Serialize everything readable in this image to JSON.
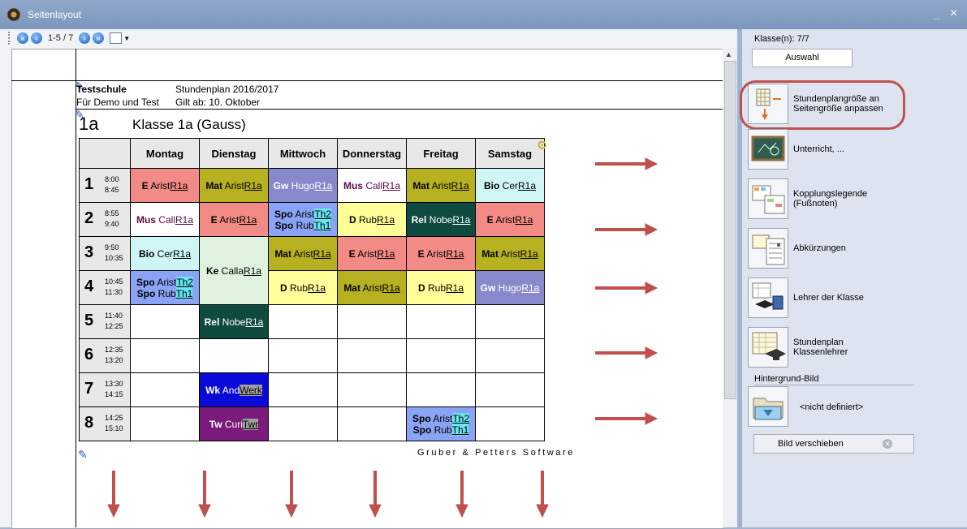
{
  "window": {
    "title": "Seitenlayout",
    "minimize": "_",
    "close": "×"
  },
  "toolbar": {
    "page_info": "1-5 / 7"
  },
  "header": {
    "school": "Testschule",
    "demo": "Für Demo und Test",
    "plan": "Stundenplan 2016/2017",
    "valid": "Gilt ab: 10. Oktober"
  },
  "class": {
    "code": "1a",
    "name": "Klasse 1a (Gauss)"
  },
  "days": [
    "Montag",
    "Dienstag",
    "Mittwoch",
    "Donnerstag",
    "Freitag",
    "Samstag"
  ],
  "periods": [
    {
      "num": "1",
      "start": "8:00",
      "end": "8:45"
    },
    {
      "num": "2",
      "start": "8:55",
      "end": "9:40"
    },
    {
      "num": "3",
      "start": "9:50",
      "end": "10:35"
    },
    {
      "num": "4",
      "start": "10:45",
      "end": "11:30"
    },
    {
      "num": "5",
      "start": "11:40",
      "end": "12:25"
    },
    {
      "num": "6",
      "start": "12:35",
      "end": "13:20"
    },
    {
      "num": "7",
      "start": "13:30",
      "end": "14:15"
    },
    {
      "num": "8",
      "start": "14:25",
      "end": "15:10"
    }
  ],
  "lessons": {
    "p1": [
      {
        "lines": [
          {
            "subj": "E",
            "teacher": "Arist",
            "room": "R1a"
          }
        ],
        "bg": "#f28b86",
        "fg": "#000"
      },
      {
        "lines": [
          {
            "subj": "Mat",
            "teacher": "Arist",
            "room": "R1a"
          }
        ],
        "bg": "#b7b020",
        "fg": "#000"
      },
      {
        "lines": [
          {
            "subj": "Gw",
            "teacher": "Hugo",
            "room": "R1a"
          }
        ],
        "bg": "#8888cc",
        "fg": "#fff"
      },
      {
        "lines": [
          {
            "subj": "Mus",
            "teacher": "Call",
            "room": "R1a"
          }
        ],
        "bg": "#ffffff",
        "fg": "#5a0a4a"
      },
      {
        "lines": [
          {
            "subj": "Mat",
            "teacher": "Arist",
            "room": "R1a"
          }
        ],
        "bg": "#b7b020",
        "fg": "#000"
      },
      {
        "lines": [
          {
            "subj": "Bio",
            "teacher": "Cer",
            "room": "R1a"
          }
        ],
        "bg": "#cff5f5",
        "fg": "#000"
      }
    ],
    "p2": [
      {
        "lines": [
          {
            "subj": "Mus",
            "teacher": "Call",
            "room": "R1a"
          }
        ],
        "bg": "#ffffff",
        "fg": "#5a0a4a"
      },
      {
        "lines": [
          {
            "subj": "E",
            "teacher": "Arist",
            "room": "R1a"
          }
        ],
        "bg": "#f28b86",
        "fg": "#000"
      },
      {
        "lines": [
          {
            "subj": "Spo",
            "teacher": "Arist",
            "room": "Th2"
          },
          {
            "subj": "Spo",
            "teacher": "Rub",
            "room": "Th1"
          }
        ],
        "bg": "#8aa3f5",
        "fg": "#000"
      },
      {
        "lines": [
          {
            "subj": "D",
            "teacher": "Rub",
            "room": "R1a"
          }
        ],
        "bg": "#ffff99",
        "fg": "#000"
      },
      {
        "lines": [
          {
            "subj": "Rel",
            "teacher": "Nobe",
            "room": "R1a"
          }
        ],
        "bg": "#0e4a40",
        "fg": "#fff"
      },
      {
        "lines": [
          {
            "subj": "E",
            "teacher": "Arist",
            "room": "R1a"
          }
        ],
        "bg": "#f28b86",
        "fg": "#000"
      }
    ],
    "p3": [
      {
        "lines": [
          {
            "subj": "Bio",
            "teacher": "Cer",
            "room": "R1a"
          }
        ],
        "bg": "#cff5f5",
        "fg": "#000"
      },
      {
        "lines": [
          {
            "subj": "Ke",
            "teacher": "Calla",
            "room": "R1a"
          }
        ],
        "bg": "#def2de",
        "fg": "#000",
        "rowspan": 2
      },
      {
        "lines": [
          {
            "subj": "Mat",
            "teacher": "Arist",
            "room": "R1a"
          }
        ],
        "bg": "#b7b020",
        "fg": "#000"
      },
      {
        "lines": [
          {
            "subj": "E",
            "teacher": "Arist",
            "room": "R1a"
          }
        ],
        "bg": "#f28b86",
        "fg": "#000"
      },
      {
        "lines": [
          {
            "subj": "E",
            "teacher": "Arist",
            "room": "R1a"
          }
        ],
        "bg": "#f28b86",
        "fg": "#000"
      },
      {
        "lines": [
          {
            "subj": "Mat",
            "teacher": "Arist",
            "room": "R1a"
          }
        ],
        "bg": "#b7b020",
        "fg": "#000"
      }
    ],
    "p4": [
      {
        "lines": [
          {
            "subj": "Spo",
            "teacher": "Arist",
            "room": "Th2"
          },
          {
            "subj": "Spo",
            "teacher": "Rub",
            "room": "Th1"
          }
        ],
        "bg": "#8aa3f5",
        "fg": "#000"
      },
      {
        "lines": [
          {
            "subj": "D",
            "teacher": "Rub",
            "room": "R1a"
          }
        ],
        "bg": "#ffff99",
        "fg": "#000"
      },
      {
        "lines": [
          {
            "subj": "Mat",
            "teacher": "Arist",
            "room": "R1a"
          }
        ],
        "bg": "#b7b020",
        "fg": "#000"
      },
      {
        "lines": [
          {
            "subj": "D",
            "teacher": "Rub",
            "room": "R1a"
          }
        ],
        "bg": "#ffff99",
        "fg": "#000"
      },
      {
        "lines": [
          {
            "subj": "Gw",
            "teacher": "Hugo",
            "room": "R1a"
          }
        ],
        "bg": "#8888cc",
        "fg": "#fff"
      }
    ],
    "p5": [
      {
        "lines": [],
        "bg": "#ffffff"
      },
      {
        "lines": [
          {
            "subj": "Rel",
            "teacher": "Nobe",
            "room": "R1a"
          }
        ],
        "bg": "#0e4a40",
        "fg": "#fff"
      },
      {
        "lines": [],
        "bg": "#ffffff"
      },
      {
        "lines": [],
        "bg": "#ffffff"
      },
      {
        "lines": [],
        "bg": "#ffffff"
      },
      {
        "lines": [],
        "bg": "#ffffff"
      }
    ],
    "p6": [
      {
        "lines": [],
        "bg": "#ffffff"
      },
      {
        "lines": [],
        "bg": "#ffffff"
      },
      {
        "lines": [],
        "bg": "#ffffff"
      },
      {
        "lines": [],
        "bg": "#ffffff"
      },
      {
        "lines": [],
        "bg": "#ffffff"
      },
      {
        "lines": [],
        "bg": "#ffffff"
      }
    ],
    "p7": [
      {
        "lines": [],
        "bg": "#ffffff"
      },
      {
        "lines": [
          {
            "subj": "Wk",
            "teacher": "And",
            "room": "Werk"
          }
        ],
        "bg": "#0a0ad8",
        "fg": "#fff"
      },
      {
        "lines": [],
        "bg": "#ffffff"
      },
      {
        "lines": [],
        "bg": "#ffffff"
      },
      {
        "lines": [],
        "bg": "#ffffff"
      },
      {
        "lines": [],
        "bg": "#ffffff"
      }
    ],
    "p8": [
      {
        "lines": [],
        "bg": "#ffffff"
      },
      {
        "lines": [
          {
            "subj": "Tw",
            "teacher": "Curi",
            "room": "Twr"
          }
        ],
        "bg": "#7a1a7a",
        "fg": "#fff"
      },
      {
        "lines": [],
        "bg": "#ffffff"
      },
      {
        "lines": [],
        "bg": "#ffffff"
      },
      {
        "lines": [
          {
            "subj": "Spo",
            "teacher": "Arist",
            "room": "Th2"
          },
          {
            "subj": "Spo",
            "teacher": "Rub",
            "room": "Th1"
          }
        ],
        "bg": "#8aa3f5",
        "fg": "#000"
      },
      {
        "lines": [],
        "bg": "#ffffff"
      }
    ]
  },
  "room_highlights": {
    "Th2": "#66e6f0",
    "Th1": "#66e6f0",
    "Werk": "#a0a0a0",
    "Twr": "#a0a0a0"
  },
  "footer": "Gruber & Petters Software",
  "sidebar": {
    "classes": "Klasse(n): 7/7",
    "select": "Auswahl",
    "commands": [
      {
        "label1": "Stundenplangröße an",
        "label2": "Seitengröße anpassen",
        "icon": "grid-resize-icon"
      },
      {
        "label1": "Unterricht, ...",
        "label2": "",
        "icon": "blackboard-icon"
      },
      {
        "label1": "Kopplungslegende",
        "label2": "(Fußnoten)",
        "icon": "legend-icon"
      },
      {
        "label1": "Abkürzungen",
        "label2": "",
        "icon": "abbreviations-icon"
      },
      {
        "label1": "Lehrer der Klasse",
        "label2": "",
        "icon": "teacher-icon"
      },
      {
        "label1": "Stundenplan",
        "label2": "Klassenlehrer",
        "icon": "class-teacher-icon"
      }
    ],
    "background_label": "Hintergrund-Bild",
    "background_value": "<nicht definiert>",
    "move_image": "Bild verschieben"
  },
  "colors": {
    "arrow": "#c0504d",
    "highlight": "#c0504d"
  }
}
